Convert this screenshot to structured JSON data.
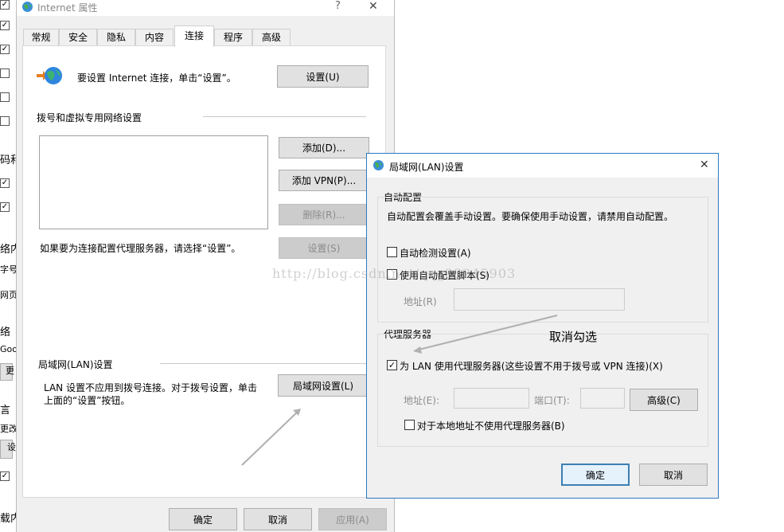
{
  "bg_strip": {
    "checks": [
      {
        "checked": true
      },
      {
        "checked": true
      },
      {
        "checked": true
      },
      {
        "checked": false
      },
      {
        "checked": false
      },
      {
        "checked": false
      },
      {
        "checked": true
      },
      {
        "checked": true
      },
      {
        "checked": true
      },
      {
        "checked": true
      }
    ],
    "fragments": [
      "码和",
      "络内",
      "字号",
      "网页",
      "络",
      "Goo",
      "更",
      "言",
      "更改",
      "设",
      "载内"
    ]
  },
  "internet_dialog": {
    "title": "Internet 属性",
    "help": "?",
    "close": "✕",
    "tabs": [
      "常规",
      "安全",
      "隐私",
      "内容",
      "连接",
      "程序",
      "高级"
    ],
    "active_tab": "连接",
    "setup_text": "要设置 Internet 连接，单击“设置”。",
    "setup_button": "设置(U)",
    "dialup_heading": "拨号和虚拟专用网络设置",
    "add_button": "添加(D)...",
    "add_vpn_button": "添加 VPN(P)...",
    "remove_button": "删除(R)...",
    "proxy_hint": "如果要为连接配置代理服务器，请选择“设置”。",
    "settings_button": "设置(S)",
    "lan_heading": "局域网(LAN)设置",
    "lan_text_line1": "LAN 设置不应用到拨号连接。对于拨号设置，单击",
    "lan_text_line2": "上面的“设置”按钮。",
    "lan_button": "局域网设置(L)",
    "ok": "确定",
    "cancel": "取消",
    "apply": "应用(A)"
  },
  "lan_dialog": {
    "title": "局域网(LAN)设置",
    "close": "✕",
    "auto_group": "自动配置",
    "auto_desc": "自动配置会覆盖手动设置。要确保使用手动设置，请禁用自动配置。",
    "auto_detect_label": "自动检测设置(A)",
    "auto_detect_checked": false,
    "auto_script_label": "使用自动配置脚本(S)",
    "auto_script_checked": false,
    "address_label": "地址(R)",
    "proxy_group": "代理服务器",
    "use_proxy_label": "为 LAN 使用代理服务器(这些设置不用于拨号或 VPN 连接)(X)",
    "use_proxy_checked": true,
    "proxy_address_label": "地址(E):",
    "port_label": "端口(T):",
    "advanced_button": "高级(C)",
    "bypass_label": "对于本地地址不使用代理服务器(B)",
    "bypass_checked": false,
    "ok": "确定",
    "cancel": "取消"
  },
  "annotation": {
    "text": "取消勾选"
  },
  "watermark": "http://blog.csdn.net/qq_33245903"
}
